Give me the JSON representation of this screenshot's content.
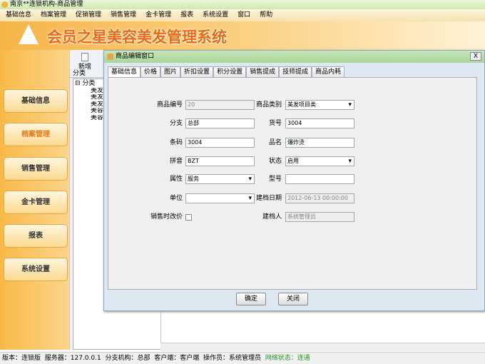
{
  "window": {
    "title": "南京**连锁机构-商品管理"
  },
  "menu": [
    "基础信息",
    "档案管理",
    "促销管理",
    "销售管理",
    "金卡管理",
    "报表",
    "系统设置",
    "窗口",
    "帮助"
  ],
  "banner": {
    "title": "会员之星美容美发管理系统"
  },
  "sidebar": {
    "items": [
      {
        "label": "基础信息"
      },
      {
        "label": "档案管理",
        "active": true
      },
      {
        "label": "销售管理"
      },
      {
        "label": "金卡管理"
      },
      {
        "label": "报表"
      },
      {
        "label": "系统设置"
      }
    ]
  },
  "panel": {
    "new_label": "新增",
    "category_header": "分类",
    "tree": {
      "root": "分类",
      "children": [
        "美发",
        "美发",
        "美发",
        "美容",
        "美容"
      ]
    }
  },
  "dialog": {
    "title": "商品编辑窗口",
    "close": "X",
    "tabs": [
      "基础信息",
      "价格",
      "图片",
      "折扣设置",
      "积分设置",
      "销售提成",
      "技师提成",
      "商品内耗"
    ],
    "active_tab": "基础信息",
    "fields": {
      "code": {
        "label": "商品编号",
        "value": "20"
      },
      "category": {
        "label": "商品类别",
        "value": "美发项目类"
      },
      "branch": {
        "label": "分支",
        "value": "总部"
      },
      "item_no": {
        "label": "货号",
        "value": "3004"
      },
      "barcode": {
        "label": "条码",
        "value": "3004"
      },
      "name": {
        "label": "品名",
        "value": "爆炸烫"
      },
      "pinyin": {
        "label": "拼音",
        "value": "BZT"
      },
      "status": {
        "label": "状态",
        "value": "启用"
      },
      "attribute": {
        "label": "属性",
        "value": "服务"
      },
      "model": {
        "label": "型号",
        "value": ""
      },
      "unit": {
        "label": "单位",
        "value": ""
      },
      "created_date": {
        "label": "建档日期",
        "value": "2012-06-13 00:00:00"
      },
      "price_change": {
        "label": "销售时改价",
        "checked": false
      },
      "creator": {
        "label": "建档人",
        "value": "系统管理员"
      }
    },
    "ok": "确定",
    "close_btn": "关闭"
  },
  "status": {
    "version": "版本：连锁版",
    "server": "服务器：127.0.0.1",
    "branch": "分支机构：总部",
    "client": "客户端：客户端",
    "operator": "操作员：系统管理员",
    "network": "网络状态：连通",
    "network_color": "#2a9a2a"
  }
}
